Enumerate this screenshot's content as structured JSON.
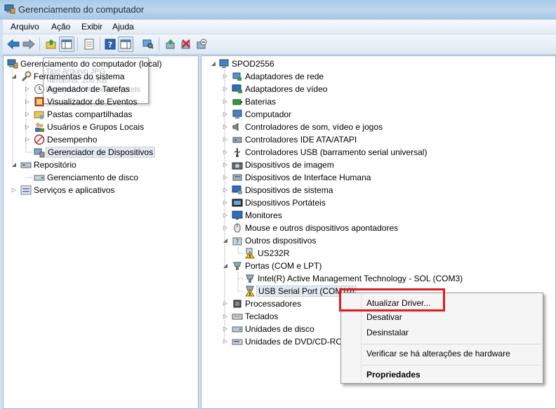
{
  "window": {
    "title": "Gerenciamento do computador"
  },
  "menu": [
    "Arquivo",
    "Ação",
    "Exibir",
    "Ajuda"
  ],
  "left_tree": {
    "root": "Gerenciamento do computador (local)",
    "ghost_lines": [
      "Tipo Arquivo JPG",
      "Tamanho: 106 KB",
      "Dimensão: 609 x 402 pixels"
    ],
    "items": [
      {
        "label": "Ferramentas do sistema"
      },
      {
        "label": "Agendador de Tarefas"
      },
      {
        "label": "Visualizador de Eventos"
      },
      {
        "label": "Pastas compartilhadas"
      },
      {
        "label": "Usuários e Grupos Locais"
      },
      {
        "label": "Desempenho"
      },
      {
        "label": "Gerenciador de Dispositivos"
      },
      {
        "label": "Repositório"
      },
      {
        "label": "Gerenciamento de disco"
      },
      {
        "label": "Serviços e aplicativos"
      }
    ]
  },
  "right_tree": {
    "root": "SPOD2556",
    "items": [
      {
        "label": "Adaptadores de rede"
      },
      {
        "label": "Adaptadores de vídeo"
      },
      {
        "label": "Baterias"
      },
      {
        "label": "Computador"
      },
      {
        "label": "Controladores de som, vídeo e jogos"
      },
      {
        "label": "Controladores IDE ATA/ATAPI"
      },
      {
        "label": "Controladores USB (barramento serial universal)"
      },
      {
        "label": "Dispositivos de imagem"
      },
      {
        "label": "Dispositivos de Interface Humana"
      },
      {
        "label": "Dispositivos de sistema"
      },
      {
        "label": "Dispositivos Portáteis"
      },
      {
        "label": "Monitores"
      },
      {
        "label": "Mouse e outros dispositivos apontadores"
      },
      {
        "label": "Outros dispositivos"
      },
      {
        "label": "US232R"
      },
      {
        "label": "Portas (COM e LPT)"
      },
      {
        "label": "Intel(R) Active Management Technology - SOL (COM3)"
      },
      {
        "label": "USB Serial Port (COM10)"
      },
      {
        "label": "Processadores"
      },
      {
        "label": "Teclados"
      },
      {
        "label": "Unidades de disco"
      },
      {
        "label": "Unidades de DVD/CD-ROM"
      }
    ]
  },
  "context_menu": {
    "update_driver": "Atualizar Driver...",
    "disable": "Desativar",
    "uninstall": "Desinstalar",
    "scan": "Verificar se há alterações de hardware",
    "properties": "Propriedades"
  },
  "colors": {
    "highlight": "#e01b1b",
    "selection": "#e3e9f1"
  }
}
